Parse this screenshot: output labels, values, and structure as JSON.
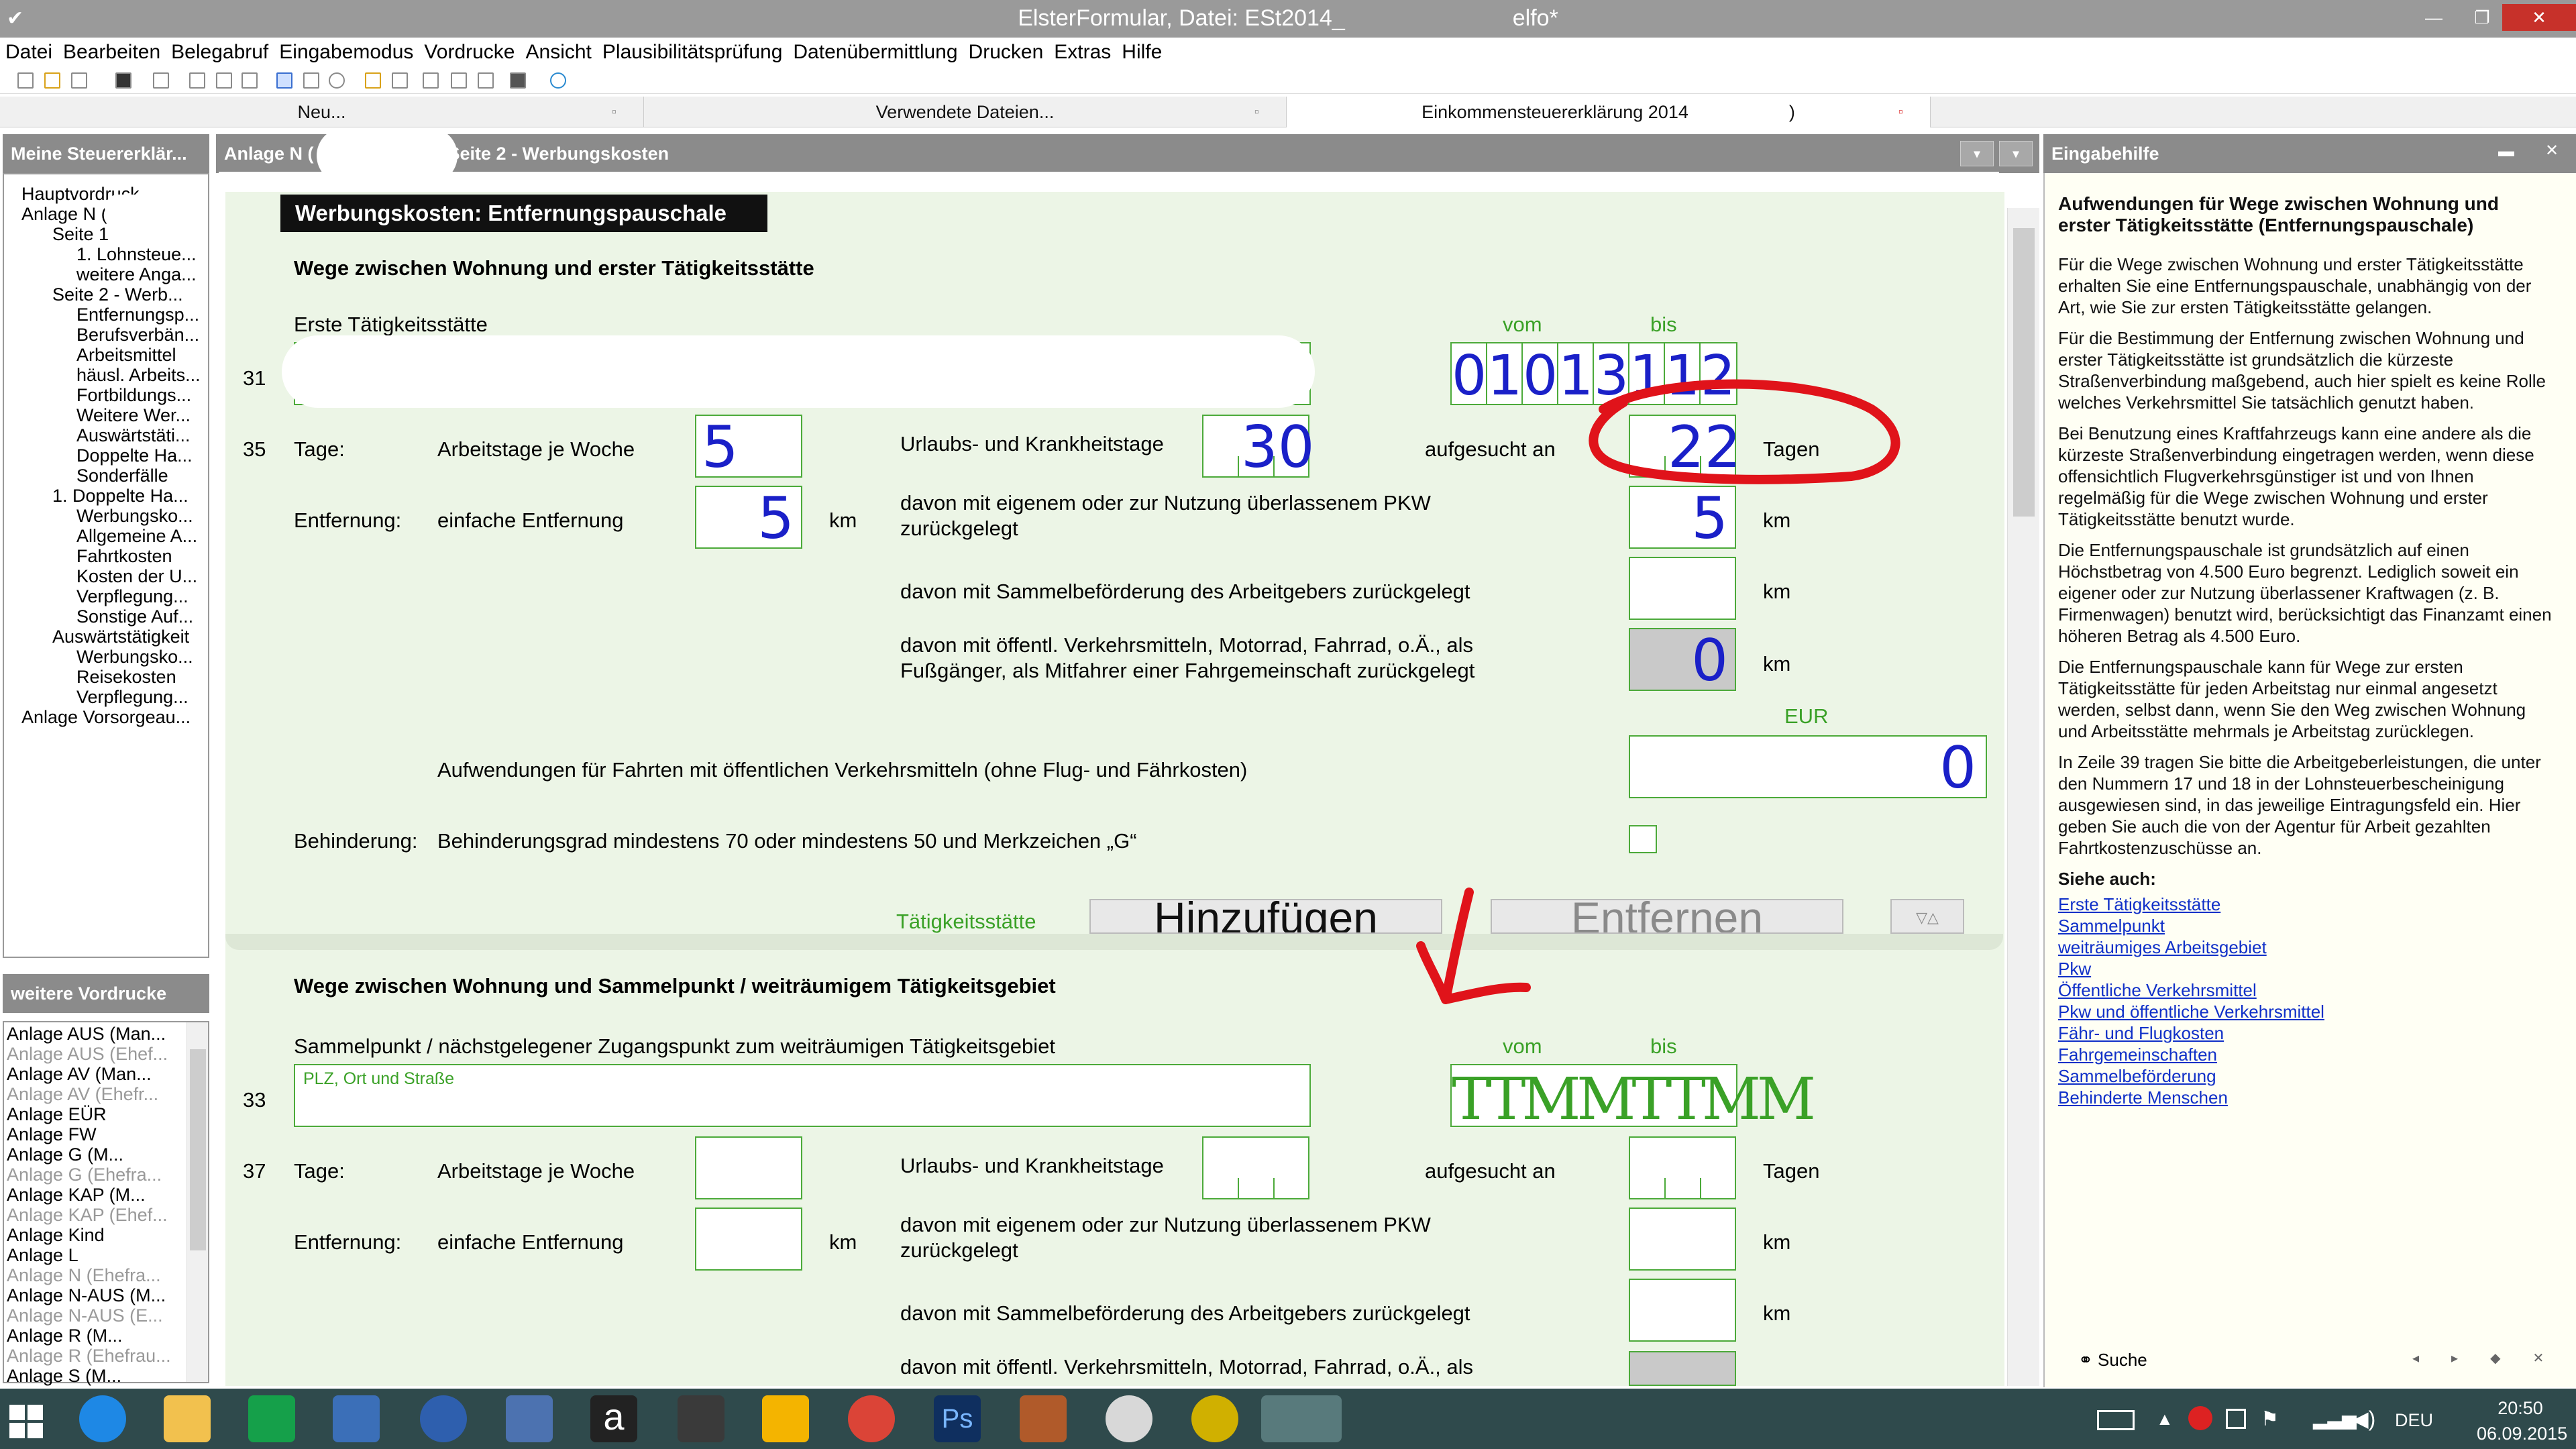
{
  "app": {
    "title": "ElsterFormular, Datei: ESt2014_",
    "title_suffix": "elfo*"
  },
  "menu": [
    "Datei",
    "Bearbeiten",
    "Belegabruf",
    "Eingabemodus",
    "Vordrucke",
    "Ansicht",
    "Plausibilitätsprüfung",
    "Datenübermittlung",
    "Drucken",
    "Extras",
    "Hilfe"
  ],
  "tabs": [
    {
      "label": "Neu..."
    },
    {
      "label": "Verwendete Dateien..."
    },
    {
      "label": "Einkommensteuererklärung 2014",
      "suffix": ")"
    }
  ],
  "left": {
    "header": "Meine Steuererklär...",
    "tree": [
      "Hauptvordruck",
      "Anlage N (",
      "Seite 1",
      "1. Lohnsteue...",
      "weitere Anga...",
      "Seite 2 - Werb...",
      "Entfernungsp...",
      "Berufsverbän...",
      "Arbeitsmittel",
      "häusl. Arbeits...",
      "Fortbildungs...",
      "Weitere Wer...",
      "Auswärtstäti...",
      "Doppelte Ha...",
      "Sonderfälle",
      "1. Doppelte Ha...",
      "Werbungsko...",
      "Allgemeine A...",
      "Fahrtkosten",
      "Kosten der U...",
      "Verpflegung...",
      "Sonstige Auf...",
      "Auswärtstätigkeit",
      "Werbungsko...",
      "Reisekosten",
      "Verpflegung...",
      "Anlage Vorsorgeau..."
    ],
    "header2": "weitere Vordrucke",
    "list": [
      {
        "t": "Anlage AUS (Man...",
        "d": false
      },
      {
        "t": "Anlage AUS (Ehef...",
        "d": true
      },
      {
        "t": "Anlage AV (Man...",
        "d": false
      },
      {
        "t": "Anlage AV (Ehefr...",
        "d": true
      },
      {
        "t": "Anlage EÜR",
        "d": false
      },
      {
        "t": "Anlage FW",
        "d": false
      },
      {
        "t": "Anlage G (M...",
        "d": false
      },
      {
        "t": "Anlage G (Ehefra...",
        "d": true
      },
      {
        "t": "Anlage KAP (M...",
        "d": false
      },
      {
        "t": "Anlage KAP (Ehef...",
        "d": true
      },
      {
        "t": "Anlage Kind",
        "d": false
      },
      {
        "t": "Anlage L",
        "d": false
      },
      {
        "t": "Anlage N (Ehefra...",
        "d": true
      },
      {
        "t": "Anlage N-AUS (M...",
        "d": false
      },
      {
        "t": "Anlage N-AUS (E...",
        "d": true
      },
      {
        "t": "Anlage R (M...",
        "d": false
      },
      {
        "t": "Anlage R (Ehefrau...",
        "d": true
      },
      {
        "t": "Anlage S (M...",
        "d": false
      }
    ]
  },
  "form": {
    "header_left": "Anlage N (",
    "header_right": "Seite 2 - Werbungskosten",
    "section_title": "Werbungskosten: Entfernungspauschale",
    "block1_heading": "Wege zwischen Wohnung und erster Tätigkeitsstätte",
    "erste_label": "Erste Tätigkeitsstätte",
    "vom": "vom",
    "bis": "bis",
    "line31": "31",
    "line35": "35",
    "line33": "33",
    "line37": "37",
    "date_digits": [
      "0",
      "1",
      "0",
      "1",
      "3",
      "1",
      "1",
      "2"
    ],
    "tage": "Tage:",
    "arbeitstage": "Arbeitstage je Woche",
    "arbeitstage_val": "5",
    "urlaub": "Urlaubs- und Krankheitstage",
    "urlaub_val": "30",
    "aufgesucht": "aufgesucht an",
    "aufgesucht_val": "22",
    "tagen": "Tagen",
    "entfernung": "Entfernung:",
    "einfache": "einfache Entfernung",
    "einfache_val": "5",
    "km": "km",
    "pkw": "davon mit eigenem oder zur Nutzung überlassenem PKW",
    "pkw2": "zurückgelegt",
    "pkw_val": "5",
    "sammel": "davon mit Sammelbeförderung des Arbeitgebers zurückgelegt",
    "oeff": "davon mit öffentl. Verkehrsmitteln, Motorrad, Fahrrad, o.Ä., als",
    "oeff2": "Fußgänger, als Mitfahrer einer Fahrgemeinschaft zurückgelegt",
    "oeff_val": "0",
    "eur": "EUR",
    "aufw": "Aufwendungen für Fahrten mit öffentlichen Verkehrsmitteln (ohne Flug- und Fährkosten)",
    "aufw_val": "0",
    "behinderung": "Behinderung:",
    "behinderung_text": "Behinderungsgrad mindestens 70 oder mindestens 50 und Merkzeichen „G“",
    "taetigkeit": "Tätigkeitsstätte",
    "add": "Hinzufügen",
    "remove": "Entfernen",
    "block2_heading": "Wege zwischen Wohnung und Sammelpunkt / weiträumigem Tätigkeitsgebiet",
    "sammelpunkt_label": "Sammelpunkt / nächstgelegener Zugangspunkt zum weiträumigen Tätigkeitsgebiet",
    "sammelpunkt_ph": "PLZ, Ort und Straße",
    "date_ph": [
      "T",
      "T",
      "M",
      "M",
      "T",
      "T",
      "M",
      "M"
    ],
    "oeff_cut": "davon mit öffentl. Verkehrsmitteln, Motorrad, Fahrrad, o.Ä., als"
  },
  "help": {
    "header": "Eingabehilfe",
    "title": "Aufwendungen für Wege zwischen Wohnung und erster Tätigkeitsstätte (Entfernungspauschale)",
    "paragraphs": [
      "Für die Wege zwischen Wohnung und erster Tätigkeitsstätte erhalten Sie eine Entfernungspauschale, unabhängig von der Art, wie Sie zur ersten Tätigkeitsstätte gelangen.",
      "Für die Bestimmung der Entfernung zwischen Wohnung und erster Tätigkeitsstätte ist grundsätzlich die kürzeste Straßenverbindung maßgebend, auch hier spielt es keine Rolle welches Verkehrsmittel Sie tatsächlich genutzt haben.",
      "Bei Benutzung eines Kraftfahrzeugs kann eine andere als die kürzeste Straßenverbindung eingetragen werden, wenn diese offensichtlich Flugverkehrsgünstiger ist und von Ihnen regelmäßig für die Wege zwischen Wohnung und erster Tätigkeitsstätte benutzt wurde.",
      "Die Entfernungspauschale ist grundsätzlich auf einen Höchstbetrag von 4.500 Euro begrenzt. Lediglich soweit ein eigener oder zur Nutzung überlassener Kraftwagen (z. B. Firmenwagen) benutzt wird, berücksichtigt das Finanzamt einen höheren Betrag als 4.500 Euro.",
      "Die Entfernungspauschale kann für Wege zur ersten Tätigkeitsstätte für jeden Arbeitstag nur einmal angesetzt werden, selbst dann, wenn Sie den Weg zwischen Wohnung und Arbeitsstätte mehrmals je Arbeitstag zurücklegen.",
      "In Zeile 39 tragen Sie bitte die Arbeitgeberleistungen, die unter den Nummern 17 und 18 in der Lohnsteuerbescheinigung ausgewiesen sind, in das jeweilige Eintragungsfeld ein. Hier geben Sie auch die von der Agentur für Arbeit gezahlten Fahrtkostenzuschüsse an."
    ],
    "see_also": "Siehe auch:",
    "links": [
      "Erste Tätigkeitsstätte",
      "Sammelpunkt",
      "weiträumiges Arbeitsgebiet",
      "Pkw",
      "Öffentliche Verkehrsmittel",
      "Pkw und öffentliche Verkehrsmittel",
      "Fähr- und Flugkosten",
      "Fahrgemeinschaften",
      "Sammelbeförderung",
      "Behinderte Menschen"
    ],
    "search": "Suche"
  },
  "taskbar": {
    "lang": "DEU",
    "time": "20:50",
    "date": "06.09.2015"
  }
}
